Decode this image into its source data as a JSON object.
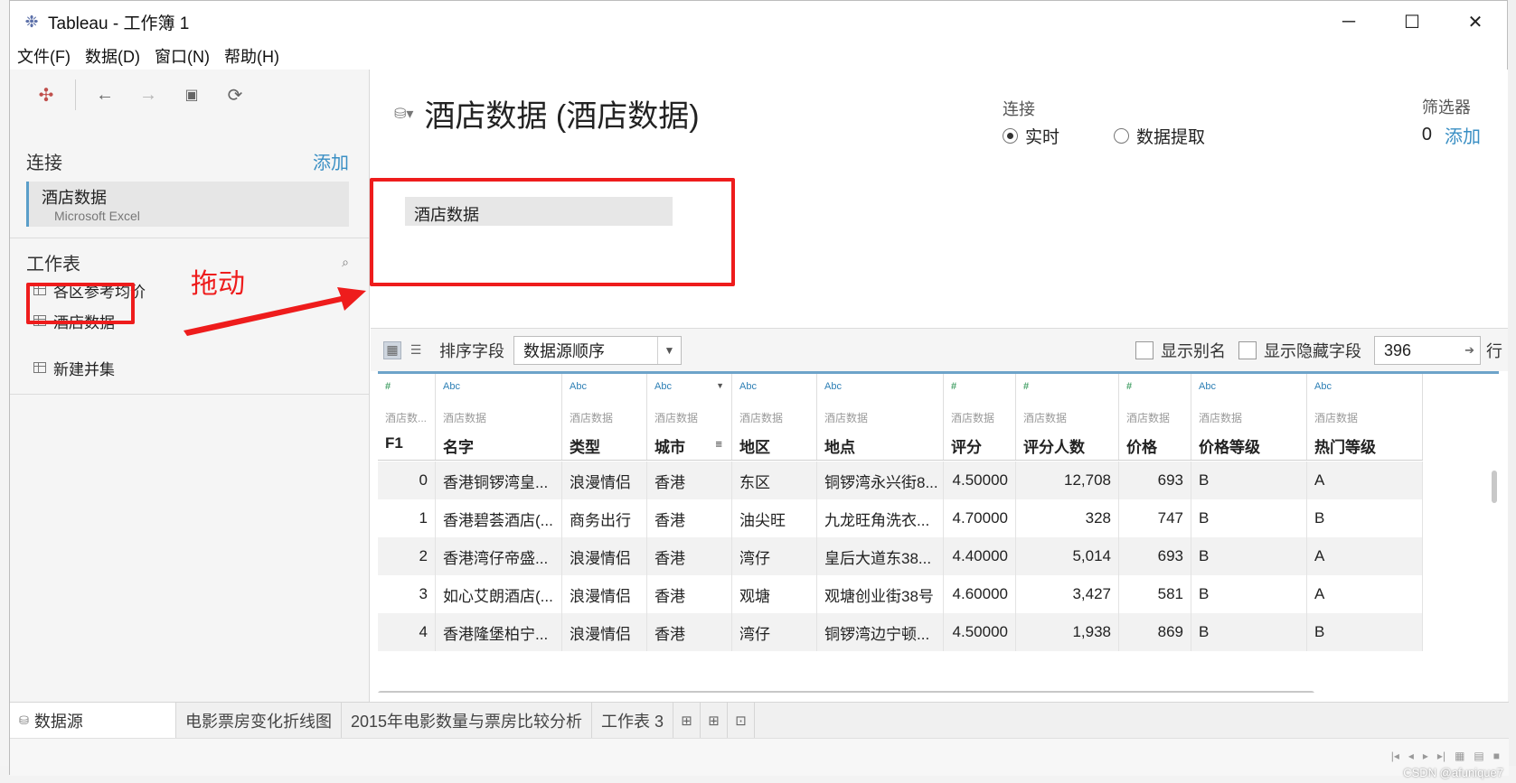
{
  "window": {
    "title": "Tableau - 工作簿 1",
    "controls": {
      "minimize": "─",
      "maximize": "☐",
      "close": "✕"
    }
  },
  "menu": [
    "文件(F)",
    "数据(D)",
    "窗口(N)",
    "帮助(H)"
  ],
  "left_panel": {
    "connections_title": "连接",
    "connections_add": "添加",
    "connection": {
      "name": "酒店数据",
      "type": "Microsoft Excel"
    },
    "sheets_title": "工作表",
    "sheets": [
      "各区参考均价",
      "酒店数据"
    ],
    "new_union": "新建并集"
  },
  "datasource": {
    "title": "酒店数据 (酒店数据)",
    "connection_label": "连接",
    "live_label": "实时",
    "extract_label": "数据提取",
    "selected_mode": "live",
    "filters_label": "筛选器",
    "filters_count": "0",
    "filters_add": "添加",
    "canvas_table": "酒店数据"
  },
  "annotation": {
    "text": "拖动",
    "color": "#ee1c1c"
  },
  "grid_toolbar": {
    "sort_label": "排序字段",
    "sort_value": "数据源顺序",
    "show_alias": "显示别名",
    "show_hidden": "显示隐藏字段",
    "rows": "396",
    "rows_unit": "行"
  },
  "grid": {
    "columns": [
      {
        "type": "#",
        "source": "酒店数...",
        "name": "F1"
      },
      {
        "type": "Abc",
        "source": "酒店数据",
        "name": "名字"
      },
      {
        "type": "Abc",
        "source": "酒店数据",
        "name": "类型"
      },
      {
        "type": "Abc",
        "source": "酒店数据",
        "name": "城市"
      },
      {
        "type": "Abc",
        "source": "酒店数据",
        "name": "地区"
      },
      {
        "type": "Abc",
        "source": "酒店数据",
        "name": "地点"
      },
      {
        "type": "#",
        "source": "酒店数据",
        "name": "评分"
      },
      {
        "type": "#",
        "source": "酒店数据",
        "name": "评分人数"
      },
      {
        "type": "#",
        "source": "酒店数据",
        "name": "价格"
      },
      {
        "type": "Abc",
        "source": "酒店数据",
        "name": "价格等级"
      },
      {
        "type": "Abc",
        "source": "酒店数据",
        "name": "热门等级"
      }
    ],
    "rows": [
      [
        "0",
        "香港铜锣湾皇...",
        "浪漫情侣",
        "香港",
        "东区",
        "铜锣湾永兴街8...",
        "4.50000",
        "12,708",
        "693",
        "B",
        "A"
      ],
      [
        "1",
        "香港碧荟酒店(...",
        "商务出行",
        "香港",
        "油尖旺",
        "九龙旺角洗衣...",
        "4.70000",
        "328",
        "747",
        "B",
        "B"
      ],
      [
        "2",
        "香港湾仔帝盛...",
        "浪漫情侣",
        "香港",
        "湾仔",
        "皇后大道东38...",
        "4.40000",
        "5,014",
        "693",
        "B",
        "A"
      ],
      [
        "3",
        "如心艾朗酒店(...",
        "浪漫情侣",
        "香港",
        "观塘",
        "观塘创业街38号",
        "4.60000",
        "3,427",
        "581",
        "B",
        "A"
      ],
      [
        "4",
        "香港隆堡柏宁...",
        "浪漫情侣",
        "香港",
        "湾仔",
        "铜锣湾边宁顿...",
        "4.50000",
        "1,938",
        "869",
        "B",
        "B"
      ]
    ]
  },
  "tabs": {
    "datasource": "数据源",
    "sheets": [
      "电影票房变化折线图",
      "2015年电影数量与票房比较分析",
      "工作表 3"
    ]
  },
  "watermark": "CSDN @afunique7"
}
